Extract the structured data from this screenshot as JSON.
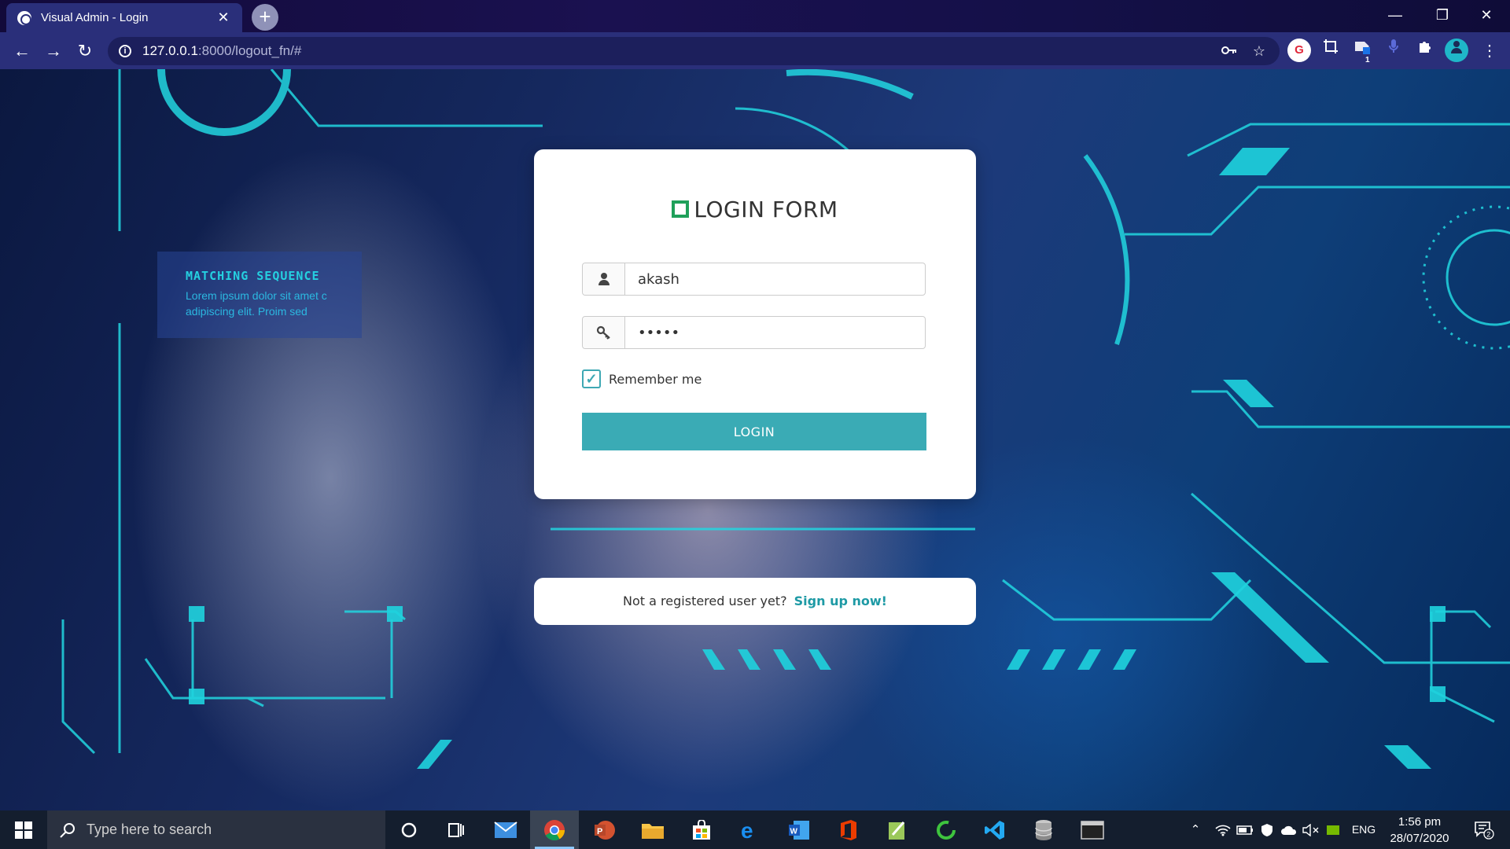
{
  "browser": {
    "tab_title": "Visual Admin - Login",
    "tab_close": "✕",
    "new_tab": "+",
    "url_host": "127.0.0.1",
    "url_path": ":8000/logout_fn/#",
    "win_minimize": "—",
    "win_restore": "❐",
    "win_close": "✕",
    "back": "←",
    "forward": "→",
    "reload": "↻",
    "extension_badge": "1"
  },
  "page": {
    "hud_title": "MATCHING SEQUENCE",
    "hud_line1": "Lorem ipsum dolor sit amet c",
    "hud_line2": "adipiscing elit. Proim sed"
  },
  "login": {
    "title": "LOGIN FORM",
    "username_value": "akash",
    "password_value": "•••••",
    "remember_label": "Remember me",
    "remember_checked": true,
    "button_label": "LOGIN"
  },
  "signup": {
    "prompt": "Not a registered user yet?",
    "link": "Sign up now!"
  },
  "taskbar": {
    "search_placeholder": "Type here to search",
    "language": "ENG",
    "time": "1:56 pm",
    "date": "28/07/2020",
    "notification_count": "2"
  },
  "colors": {
    "accent": "#3aabb5",
    "link": "#1e9aa5",
    "title_icon": "#1fa05a",
    "browser_chrome": "#2a2f7a"
  }
}
